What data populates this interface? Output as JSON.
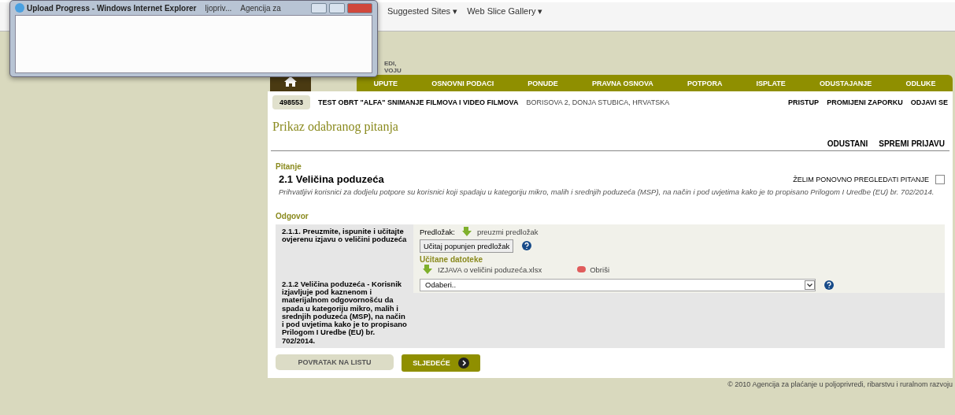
{
  "browser": {
    "tabs_visible": [
      "ljopriv...",
      "Agencija za"
    ],
    "favorites": [
      {
        "label": "Suggested Sites ▾"
      },
      {
        "label": "Web Slice Gallery ▾"
      }
    ]
  },
  "popup": {
    "title": "Upload Progress - Windows Internet Explorer"
  },
  "logo": {
    "lines": [
      "EDI,",
      "VOJU"
    ]
  },
  "nav": {
    "items": [
      "UPUTE",
      "OSNOVNI PODACI",
      "PONUDE",
      "PRAVNA OSNOVA",
      "POTPORA",
      "ISPLATE",
      "ODUSTAJANJE",
      "ODLUKE"
    ]
  },
  "user_bar": {
    "id": "498553",
    "name": "TEST OBRT \"ALFA\" SNIMANJE FILMOVA I VIDEO FILMOVA",
    "address": "BORISOVA 2, DONJA STUBICA, HRVATSKA",
    "links": [
      "PRISTUP",
      "PROMIJENI ZAPORKU",
      "ODJAVI SE"
    ]
  },
  "page_title": "Prikaz odabranog pitanja",
  "actions": [
    "ODUSTANI",
    "SPREMI PRIJAVU"
  ],
  "question": {
    "section": "Pitanje",
    "title": "2.1 Veličina poduzeća",
    "review_label": "ŽELIM PONOVNO PREGLEDATI PITANJE",
    "review_checked": false,
    "description": "Prihvatljivi korisnici za dodjelu potpore su korisnici koji spadaju u kategoriju mikro, malih i srednjih poduzeća (MSP), na način i pod uvjetima kako je to propisano Prilogom I Uredbe (EU) br. 702/2014."
  },
  "answer": {
    "section": "Odgovor",
    "rows": [
      {
        "kind": "upload",
        "label": "2.1.1. Preuzmite, ispunite i učitajte ovjerenu izjavu o veličini poduzeća",
        "template_label": "Predložak:",
        "template_link": "preuzmi predložak",
        "upload_button": "Učitaj popunjen predložak",
        "files_heading": "Učitane datoteke",
        "file": "IZJAVA o veličini poduzeća.xlsx",
        "delete": "Obriši"
      },
      {
        "kind": "select",
        "label": "2.1.2 Veličina poduzeća - Korisnik izjavljuje pod kaznenom i materijalnom odgovornošću da spada u kategoriju mikro, malih i srednjih poduzeća (MSP), na način i pod uvjetima kako je to propisano Prilogom I Uredbe (EU) br. 702/2014.",
        "value": "Odaberi.."
      }
    ]
  },
  "buttons": {
    "back": "POVRATAK NA LISTU",
    "next": "SLJEDEĆE"
  },
  "footer": "© 2010 Agencija za plaćanje u poljoprivredi, ribarstvu i ruralnom razvoju"
}
